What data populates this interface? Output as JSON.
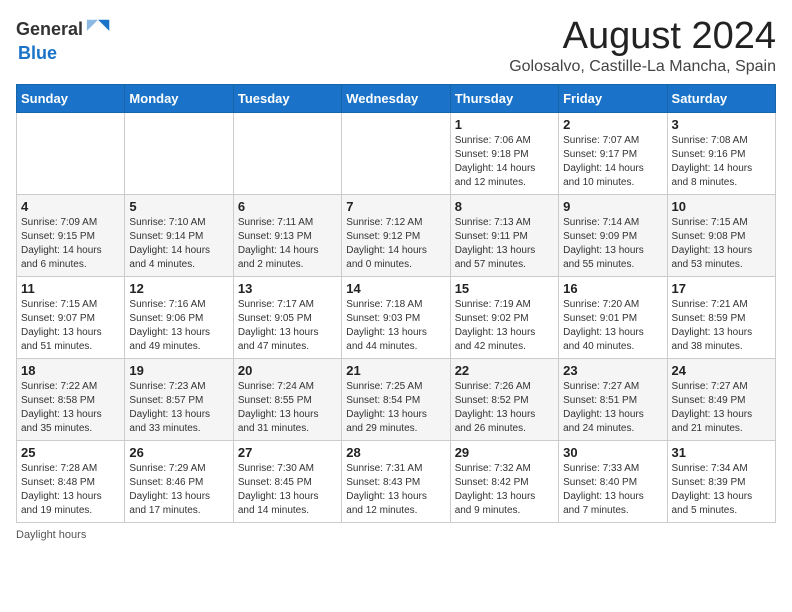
{
  "header": {
    "logo_general": "General",
    "logo_blue": "Blue",
    "month_year": "August 2024",
    "location": "Golosalvo, Castille-La Mancha, Spain"
  },
  "weekdays": [
    "Sunday",
    "Monday",
    "Tuesday",
    "Wednesday",
    "Thursday",
    "Friday",
    "Saturday"
  ],
  "weeks": [
    [
      {
        "day": "",
        "info": ""
      },
      {
        "day": "",
        "info": ""
      },
      {
        "day": "",
        "info": ""
      },
      {
        "day": "",
        "info": ""
      },
      {
        "day": "1",
        "info": "Sunrise: 7:06 AM\nSunset: 9:18 PM\nDaylight: 14 hours\nand 12 minutes."
      },
      {
        "day": "2",
        "info": "Sunrise: 7:07 AM\nSunset: 9:17 PM\nDaylight: 14 hours\nand 10 minutes."
      },
      {
        "day": "3",
        "info": "Sunrise: 7:08 AM\nSunset: 9:16 PM\nDaylight: 14 hours\nand 8 minutes."
      }
    ],
    [
      {
        "day": "4",
        "info": "Sunrise: 7:09 AM\nSunset: 9:15 PM\nDaylight: 14 hours\nand 6 minutes."
      },
      {
        "day": "5",
        "info": "Sunrise: 7:10 AM\nSunset: 9:14 PM\nDaylight: 14 hours\nand 4 minutes."
      },
      {
        "day": "6",
        "info": "Sunrise: 7:11 AM\nSunset: 9:13 PM\nDaylight: 14 hours\nand 2 minutes."
      },
      {
        "day": "7",
        "info": "Sunrise: 7:12 AM\nSunset: 9:12 PM\nDaylight: 14 hours\nand 0 minutes."
      },
      {
        "day": "8",
        "info": "Sunrise: 7:13 AM\nSunset: 9:11 PM\nDaylight: 13 hours\nand 57 minutes."
      },
      {
        "day": "9",
        "info": "Sunrise: 7:14 AM\nSunset: 9:09 PM\nDaylight: 13 hours\nand 55 minutes."
      },
      {
        "day": "10",
        "info": "Sunrise: 7:15 AM\nSunset: 9:08 PM\nDaylight: 13 hours\nand 53 minutes."
      }
    ],
    [
      {
        "day": "11",
        "info": "Sunrise: 7:15 AM\nSunset: 9:07 PM\nDaylight: 13 hours\nand 51 minutes."
      },
      {
        "day": "12",
        "info": "Sunrise: 7:16 AM\nSunset: 9:06 PM\nDaylight: 13 hours\nand 49 minutes."
      },
      {
        "day": "13",
        "info": "Sunrise: 7:17 AM\nSunset: 9:05 PM\nDaylight: 13 hours\nand 47 minutes."
      },
      {
        "day": "14",
        "info": "Sunrise: 7:18 AM\nSunset: 9:03 PM\nDaylight: 13 hours\nand 44 minutes."
      },
      {
        "day": "15",
        "info": "Sunrise: 7:19 AM\nSunset: 9:02 PM\nDaylight: 13 hours\nand 42 minutes."
      },
      {
        "day": "16",
        "info": "Sunrise: 7:20 AM\nSunset: 9:01 PM\nDaylight: 13 hours\nand 40 minutes."
      },
      {
        "day": "17",
        "info": "Sunrise: 7:21 AM\nSunset: 8:59 PM\nDaylight: 13 hours\nand 38 minutes."
      }
    ],
    [
      {
        "day": "18",
        "info": "Sunrise: 7:22 AM\nSunset: 8:58 PM\nDaylight: 13 hours\nand 35 minutes."
      },
      {
        "day": "19",
        "info": "Sunrise: 7:23 AM\nSunset: 8:57 PM\nDaylight: 13 hours\nand 33 minutes."
      },
      {
        "day": "20",
        "info": "Sunrise: 7:24 AM\nSunset: 8:55 PM\nDaylight: 13 hours\nand 31 minutes."
      },
      {
        "day": "21",
        "info": "Sunrise: 7:25 AM\nSunset: 8:54 PM\nDaylight: 13 hours\nand 29 minutes."
      },
      {
        "day": "22",
        "info": "Sunrise: 7:26 AM\nSunset: 8:52 PM\nDaylight: 13 hours\nand 26 minutes."
      },
      {
        "day": "23",
        "info": "Sunrise: 7:27 AM\nSunset: 8:51 PM\nDaylight: 13 hours\nand 24 minutes."
      },
      {
        "day": "24",
        "info": "Sunrise: 7:27 AM\nSunset: 8:49 PM\nDaylight: 13 hours\nand 21 minutes."
      }
    ],
    [
      {
        "day": "25",
        "info": "Sunrise: 7:28 AM\nSunset: 8:48 PM\nDaylight: 13 hours\nand 19 minutes."
      },
      {
        "day": "26",
        "info": "Sunrise: 7:29 AM\nSunset: 8:46 PM\nDaylight: 13 hours\nand 17 minutes."
      },
      {
        "day": "27",
        "info": "Sunrise: 7:30 AM\nSunset: 8:45 PM\nDaylight: 13 hours\nand 14 minutes."
      },
      {
        "day": "28",
        "info": "Sunrise: 7:31 AM\nSunset: 8:43 PM\nDaylight: 13 hours\nand 12 minutes."
      },
      {
        "day": "29",
        "info": "Sunrise: 7:32 AM\nSunset: 8:42 PM\nDaylight: 13 hours\nand 9 minutes."
      },
      {
        "day": "30",
        "info": "Sunrise: 7:33 AM\nSunset: 8:40 PM\nDaylight: 13 hours\nand 7 minutes."
      },
      {
        "day": "31",
        "info": "Sunrise: 7:34 AM\nSunset: 8:39 PM\nDaylight: 13 hours\nand 5 minutes."
      }
    ]
  ],
  "footer": {
    "note": "Daylight hours"
  }
}
